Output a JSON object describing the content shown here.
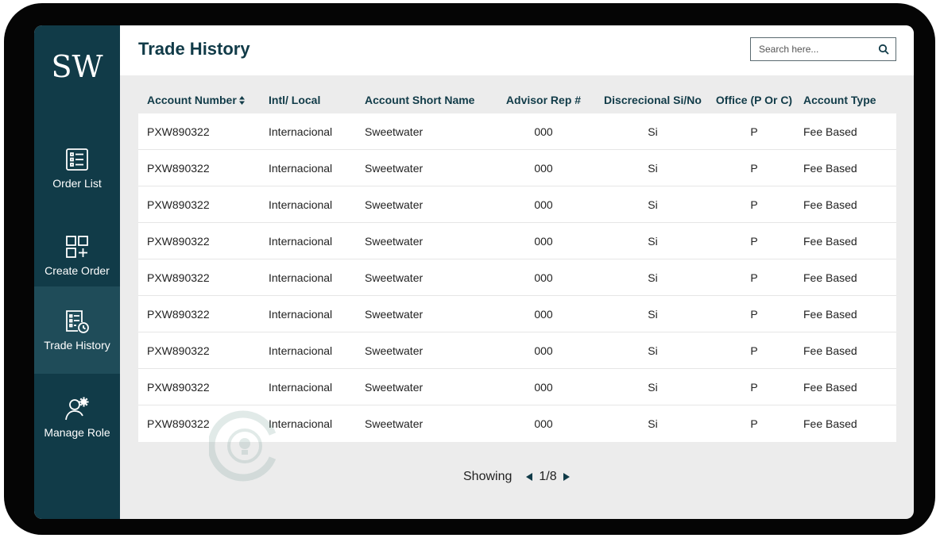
{
  "sidebar": {
    "logo": "SW",
    "items": [
      {
        "label": "Order List",
        "icon": "order-list-icon"
      },
      {
        "label": "Create Order",
        "icon": "create-order-icon"
      },
      {
        "label": "Trade History",
        "icon": "trade-history-icon",
        "active": true
      },
      {
        "label": "Manage Role",
        "icon": "manage-role-icon"
      }
    ]
  },
  "header": {
    "title": "Trade History",
    "search_placeholder": "Search here..."
  },
  "table": {
    "columns": [
      "Account Number",
      "Intl/ Local",
      "Account Short Name",
      "Advisor Rep #",
      "Discrecional Si/No",
      "Office (P Or C)",
      "Account Type"
    ],
    "rows": [
      [
        "PXW890322",
        "Internacional",
        "Sweetwater",
        "000",
        "Si",
        "P",
        "Fee Based"
      ],
      [
        "PXW890322",
        "Internacional",
        "Sweetwater",
        "000",
        "Si",
        "P",
        "Fee Based"
      ],
      [
        "PXW890322",
        "Internacional",
        "Sweetwater",
        "000",
        "Si",
        "P",
        "Fee Based"
      ],
      [
        "PXW890322",
        "Internacional",
        "Sweetwater",
        "000",
        "Si",
        "P",
        "Fee Based"
      ],
      [
        "PXW890322",
        "Internacional",
        "Sweetwater",
        "000",
        "Si",
        "P",
        "Fee Based"
      ],
      [
        "PXW890322",
        "Internacional",
        "Sweetwater",
        "000",
        "Si",
        "P",
        "Fee Based"
      ],
      [
        "PXW890322",
        "Internacional",
        "Sweetwater",
        "000",
        "Si",
        "P",
        "Fee Based"
      ],
      [
        "PXW890322",
        "Internacional",
        "Sweetwater",
        "000",
        "Si",
        "P",
        "Fee Based"
      ],
      [
        "PXW890322",
        "Internacional",
        "Sweetwater",
        "000",
        "Si",
        "P",
        "Fee Based"
      ]
    ]
  },
  "pagination": {
    "showing_label": "Showing",
    "pages": "1/8"
  },
  "colors": {
    "sidebar": "#113b48",
    "sidebar_active": "#1f4c59",
    "accent_text": "#113b48",
    "background": "#ececec"
  }
}
